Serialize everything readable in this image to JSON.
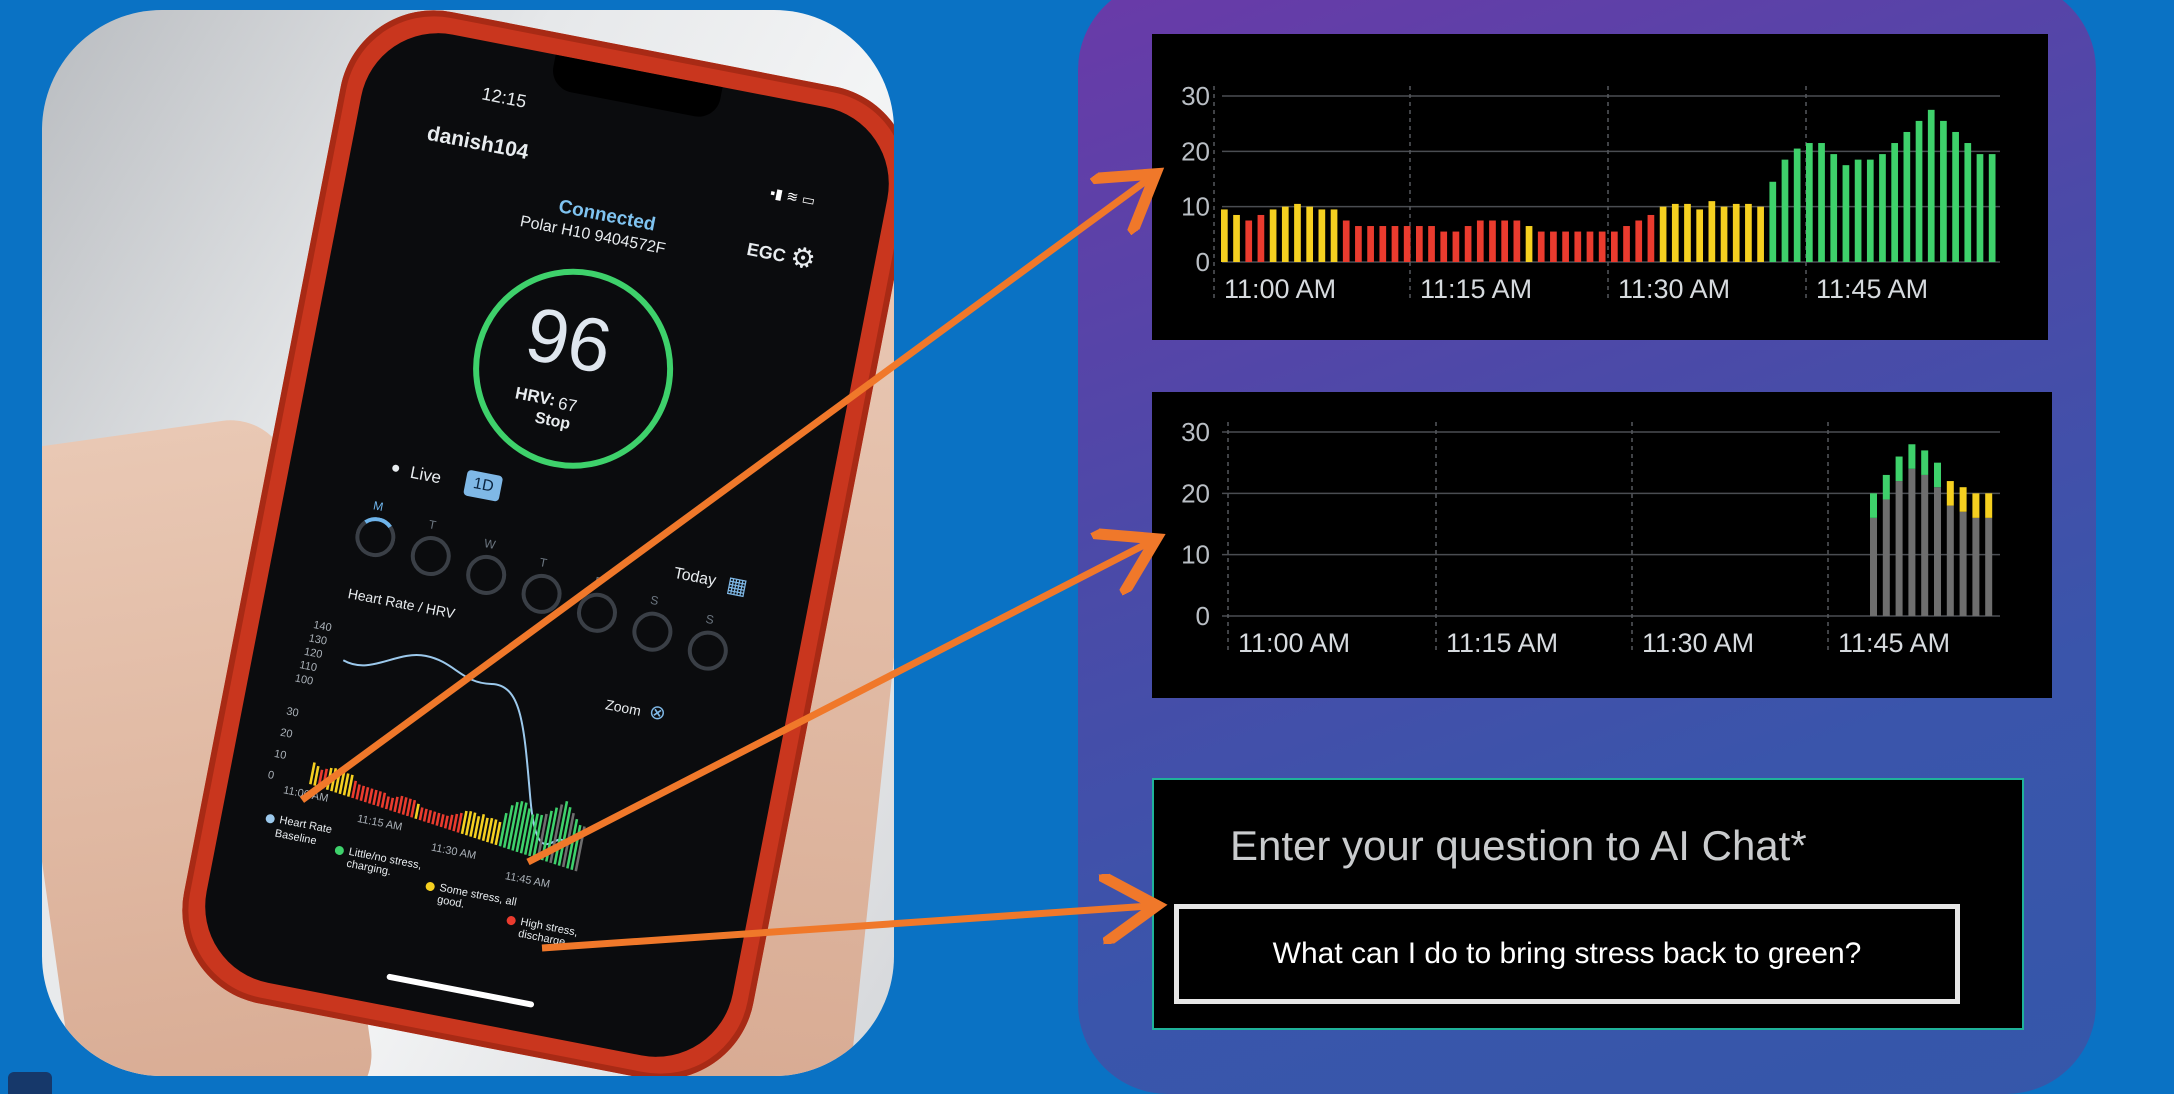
{
  "phone": {
    "time": "12:15",
    "username": "danish104",
    "status": "Connected",
    "device": "Polar H10 9404572F",
    "ecg_label": "EGC",
    "score": "96",
    "hrv_label": "HRV:",
    "hrv_value": "67",
    "stop_label": "Stop",
    "live_label": "Live",
    "range_button": "1D",
    "today_label": "Today",
    "days": [
      "M",
      "T",
      "W",
      "T",
      "F",
      "S",
      "S"
    ],
    "chart_title": "Heart Rate / HRV",
    "zoom_label": "Zoom",
    "hr_ticks": [
      "140",
      "130",
      "120",
      "110",
      "100"
    ],
    "stress_ticks": [
      "30",
      "20",
      "10",
      "0"
    ],
    "time_ticks": [
      "11:00 AM",
      "11:15 AM",
      "11:30 AM",
      "11:45 AM"
    ],
    "legend": {
      "heart_rate": "Heart Rate",
      "baseline": "Baseline",
      "green": "Little/no stress, charging.",
      "yellow": "Some stress, all good.",
      "red": "High stress, discharge"
    }
  },
  "colors": {
    "background": "#0a72c4",
    "green": "#3ed16b",
    "yellow": "#f5d020",
    "red": "#ea3b2e",
    "grey": "#6e6e6e",
    "arrow": "#f0782a",
    "chat_border": "#1fb29a"
  },
  "chart_data": [
    {
      "type": "bar",
      "y_ticks": [
        "30",
        "20",
        "10",
        "0"
      ],
      "ylim": [
        0,
        30
      ],
      "x_ticks": [
        "11:00 AM",
        "11:15 AM",
        "11:30 AM",
        "11:45 AM"
      ],
      "values": [
        9.5,
        8.5,
        7.5,
        8.5,
        9.5,
        10,
        10.5,
        10,
        9.5,
        9.5,
        7.5,
        6.5,
        6.5,
        6.5,
        6.5,
        6.5,
        6.5,
        6.5,
        5.5,
        5.5,
        6.5,
        7.5,
        7.5,
        7.5,
        7.5,
        6.5,
        5.5,
        5.5,
        5.5,
        5.5,
        5.5,
        5.5,
        5.5,
        6.5,
        7.5,
        8.5,
        10,
        10.5,
        10.5,
        9.5,
        11,
        10,
        10.5,
        10.5,
        10,
        14.5,
        18.5,
        20.5,
        21.5,
        21.5,
        19.5,
        17.5,
        18.5,
        18.5,
        19.5,
        21.5,
        23.5,
        25.5,
        27.5,
        25.5,
        23.5,
        21.5,
        19.5,
        19.5
      ],
      "colors": [
        "yellow",
        "yellow",
        "red",
        "red",
        "yellow",
        "yellow",
        "yellow",
        "yellow",
        "yellow",
        "yellow",
        "red",
        "red",
        "red",
        "red",
        "red",
        "red",
        "red",
        "red",
        "red",
        "red",
        "red",
        "red",
        "red",
        "red",
        "red",
        "yellow",
        "red",
        "red",
        "red",
        "red",
        "red",
        "red",
        "red",
        "red",
        "red",
        "red",
        "yellow",
        "yellow",
        "yellow",
        "yellow",
        "yellow",
        "yellow",
        "yellow",
        "yellow",
        "yellow",
        "green",
        "green",
        "green",
        "green",
        "green",
        "green",
        "green",
        "green",
        "green",
        "green",
        "green",
        "green",
        "green",
        "green",
        "green",
        "green",
        "green",
        "green",
        "green"
      ]
    },
    {
      "type": "bar",
      "stacked": true,
      "y_ticks": [
        "30",
        "20",
        "10",
        "0"
      ],
      "ylim": [
        0,
        30
      ],
      "x_ticks": [
        "11:00 AM",
        "11:15 AM",
        "11:30 AM",
        "11:45 AM"
      ],
      "base_values": [
        16,
        19,
        22,
        24,
        23,
        21,
        18,
        17,
        16,
        16
      ],
      "top_values": [
        4,
        4,
        4,
        4,
        4,
        4,
        4,
        4,
        4,
        4
      ],
      "top_colors": [
        "green",
        "green",
        "green",
        "green",
        "green",
        "green",
        "yellow",
        "yellow",
        "yellow",
        "yellow"
      ]
    }
  ],
  "chat": {
    "prompt": "Enter your question to AI Chat*",
    "input_value": "What can I do to bring stress back to green?"
  }
}
